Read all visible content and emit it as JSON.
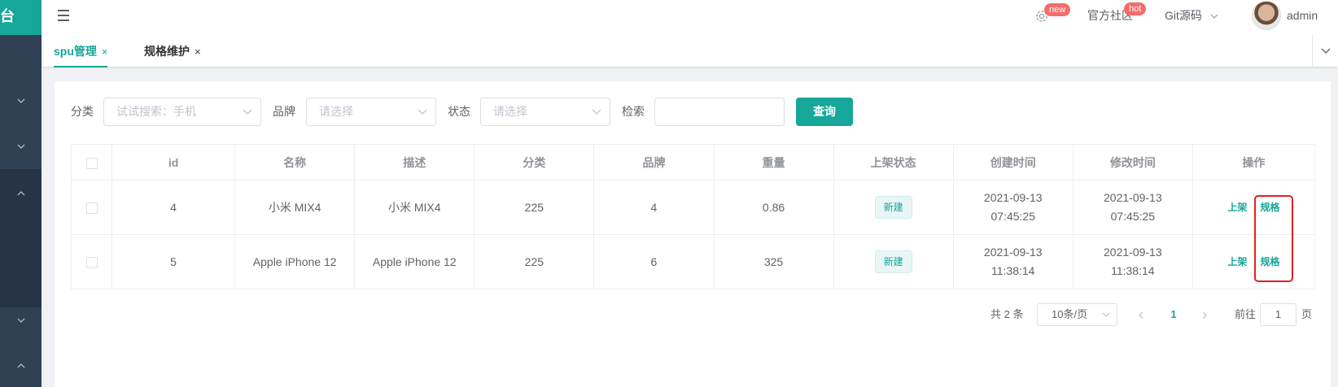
{
  "sidebar": {
    "logo_text": "台"
  },
  "header": {
    "badge_new": "new",
    "community": "官方社区",
    "badge_hot": "hot",
    "git": "Git源码",
    "username": "admin"
  },
  "tabs": [
    {
      "label": "spu管理",
      "close": "×"
    },
    {
      "label": "规格维护",
      "close": "×"
    }
  ],
  "filters": {
    "category_label": "分类",
    "category_placeholder": "试试搜索：手机",
    "brand_label": "品牌",
    "brand_placeholder": "请选择",
    "status_label": "状态",
    "status_placeholder": "请选择",
    "search_label": "检索",
    "search_value": "",
    "query_button": "查询"
  },
  "table": {
    "headers": [
      "id",
      "名称",
      "描述",
      "分类",
      "品牌",
      "重量",
      "上架状态",
      "创建时间",
      "修改时间",
      "操作"
    ],
    "rows": [
      {
        "id": "4",
        "name": "小米 MIX4",
        "desc": "小米 MIX4",
        "category": "225",
        "brand": "4",
        "weight": "0.86",
        "status": "新建",
        "created": "2021-09-13 07:45:25",
        "modified": "2021-09-13 07:45:25",
        "op_publish": "上架",
        "op_spec": "规格"
      },
      {
        "id": "5",
        "name": "Apple iPhone 12",
        "desc": "Apple iPhone 12",
        "category": "225",
        "brand": "6",
        "weight": "325",
        "status": "新建",
        "created": "2021-09-13 11:38:14",
        "modified": "2021-09-13 11:38:14",
        "op_publish": "上架",
        "op_spec": "规格"
      }
    ]
  },
  "pagination": {
    "total": "共 2 条",
    "page_size": "10条/页",
    "prev": "‹",
    "current": "1",
    "next": "›",
    "goto_prefix": "前往",
    "goto_value": "1",
    "goto_suffix": "页"
  },
  "colors": {
    "accent": "#17a69a",
    "sidebar": "#304156",
    "highlight": "#e02020",
    "badge": "#f56c6c"
  }
}
